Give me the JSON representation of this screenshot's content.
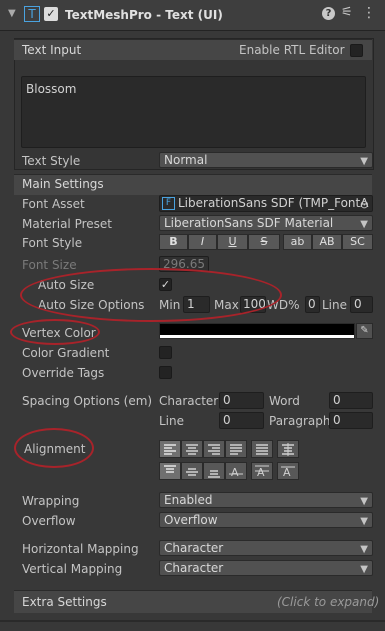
{
  "header": {
    "title": "TextMeshPro - Text (UI)"
  },
  "text_input": {
    "section_title": "Text Input",
    "rtl_label": "Enable RTL Editor",
    "value": "Blossom"
  },
  "text_style": {
    "label": "Text Style",
    "value": "Normal"
  },
  "main_settings": {
    "title": "Main Settings",
    "font_asset": {
      "label": "Font Asset",
      "value": "LiberationSans SDF (TMP_FontA"
    },
    "material_preset": {
      "label": "Material Preset",
      "value": "LiberationSans SDF Material"
    },
    "font_style": {
      "label": "Font Style",
      "buttons": [
        "B",
        "I",
        "U",
        "S",
        "ab",
        "AB",
        "SC"
      ]
    },
    "font_size": {
      "label": "Font Size",
      "value": "296.65"
    },
    "auto_size": {
      "label": "Auto Size"
    },
    "auto_size_options": {
      "label": "Auto Size Options",
      "min_label": "Min",
      "min_value": "1",
      "max_label": "Max",
      "max_value": "100",
      "wd_label": "WD%",
      "wd_value": "0",
      "line_label": "Line",
      "line_value": "0"
    },
    "vertex_color": {
      "label": "Vertex Color",
      "color": "#ffffff"
    },
    "color_gradient": {
      "label": "Color Gradient"
    },
    "override_tags": {
      "label": "Override Tags"
    },
    "spacing": {
      "label": "Spacing Options (em)",
      "character_label": "Character",
      "character_value": "0",
      "word_label": "Word",
      "word_value": "0",
      "line_label": "Line",
      "line_value": "0",
      "paragraph_label": "Paragraph",
      "paragraph_value": "0"
    },
    "alignment": {
      "label": "Alignment"
    },
    "wrapping": {
      "label": "Wrapping",
      "value": "Enabled"
    },
    "overflow": {
      "label": "Overflow",
      "value": "Overflow"
    },
    "horizontal_mapping": {
      "label": "Horizontal Mapping",
      "value": "Character"
    },
    "vertical_mapping": {
      "label": "Vertical Mapping",
      "value": "Character"
    }
  },
  "extra_settings": {
    "title": "Extra Settings",
    "hint": "(Click to expand)"
  },
  "colors": {
    "annotation": "#a8232a",
    "panel": "#383838",
    "accent_icon": "#4aa3e0"
  }
}
